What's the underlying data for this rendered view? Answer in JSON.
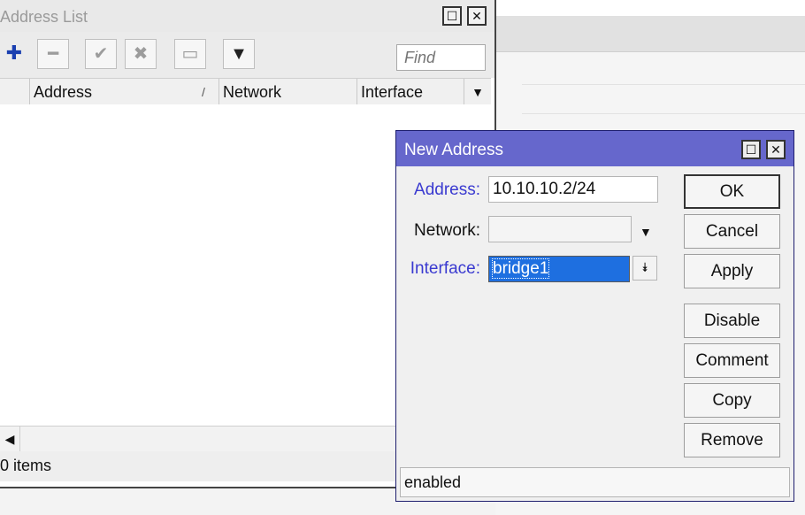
{
  "address_list": {
    "title": "Address List",
    "toolbar": {
      "add_glyph": "✚",
      "remove_glyph": "━",
      "enable_glyph": "✔",
      "disable_glyph": "✖",
      "comment_glyph": "▭",
      "filter_glyph": "▼",
      "find_placeholder": "Find"
    },
    "columns": [
      "Address",
      "Network",
      "Interface"
    ],
    "sort_glyph": "/",
    "status": "0 items"
  },
  "dialog": {
    "title": "New Address",
    "address_label": "Address:",
    "address_value": "10.10.10.2/24",
    "network_label": "Network:",
    "network_value": "",
    "interface_label": "Interface:",
    "interface_value": "bridge1",
    "buttons": {
      "ok": "OK",
      "cancel": "Cancel",
      "apply": "Apply",
      "disable": "Disable",
      "comment": "Comment",
      "copy": "Copy",
      "remove": "Remove"
    },
    "status": "enabled"
  },
  "colors": {
    "dialog_title_bar": "#6667cc",
    "label_accent": "#3a3ad0",
    "selection": "#1e6fe0",
    "add_icon": "#1a3fb0"
  }
}
